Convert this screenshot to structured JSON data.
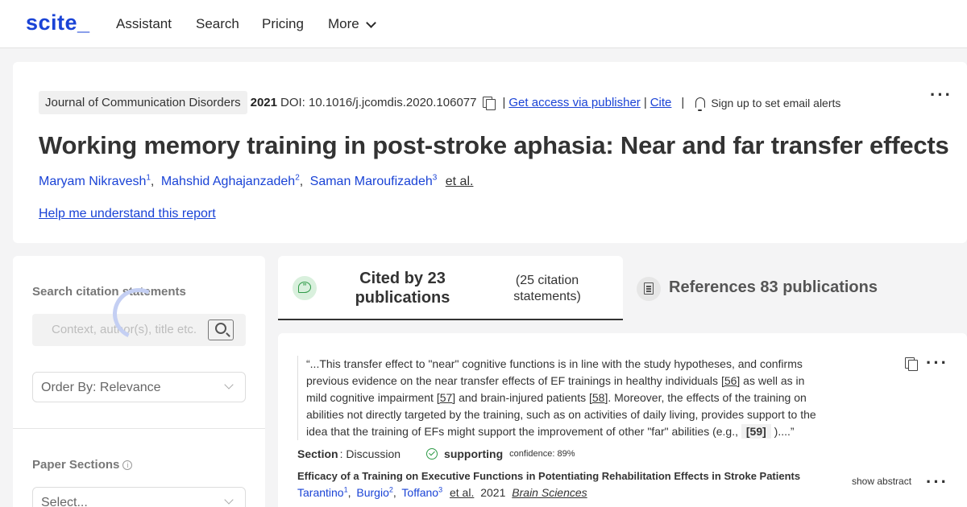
{
  "nav": {
    "logo": "scite_",
    "items": [
      "Assistant",
      "Search",
      "Pricing",
      "More"
    ]
  },
  "header": {
    "journal": "Journal of Communication Disorders",
    "year": "2021",
    "doi": "DOI: 10.1016/j.jcomdis.2020.106077",
    "get_access": "Get access via publisher",
    "cite": "Cite",
    "alerts": "Sign up to set email alerts",
    "title": "Working memory training in post-stroke aphasia: Near and far transfer effects",
    "authors": [
      {
        "name": "Maryam Nikravesh",
        "sup": "1"
      },
      {
        "name": "Mahshid Aghajanzadeh",
        "sup": "2"
      },
      {
        "name": "Saman Maroufizadeh",
        "sup": "3"
      }
    ],
    "etal": "et al.",
    "help_link": "Help me understand this report"
  },
  "sidebar": {
    "search_label": "Search citation statements",
    "search_placeholder": "Context, author(s), title etc.",
    "order_by": "Order By: Relevance",
    "paper_sections_label": "Paper Sections",
    "select_placeholder": "Select..."
  },
  "tabs": {
    "cited_main": "Cited by 23 publications",
    "cited_sub": "(25 citation statements)",
    "references": "References 83 publications"
  },
  "citation": {
    "quote_parts": [
      "“...This transfer effect to \"near\" cognitive functions is in line with the study hypotheses, and confirms previous evidence on the near transfer effects of EF trainings in healthy individuals ",
      "[56]",
      " as well as in mild cognitive impairment ",
      "[57]",
      " and brain-injured patients ",
      "[58]",
      ". Moreover, the effects of the training on abilities not directly targeted by the training, such as on activities of daily living, provides support to the idea that the training of EFs might support the improvement of other \"far\" abilities (e.g., ",
      "[59]",
      " )....”"
    ],
    "section_label": "Section",
    "section_value": ": Discussion",
    "support_label": "supporting",
    "confidence": "confidence: 89%",
    "paper_title": "Efficacy of a Training on Executive Functions in Potentiating Rehabilitation Effects in Stroke Patients",
    "paper_authors": [
      {
        "name": "Tarantino",
        "sup": "1"
      },
      {
        "name": "Burgio",
        "sup": "2"
      },
      {
        "name": "Toffano",
        "sup": "3"
      }
    ],
    "paper_etal": "et al.",
    "paper_year": "2021",
    "paper_journal": "Brain Sciences",
    "show_abstract": "show abstract"
  },
  "colors": {
    "brand": "#1a43d6",
    "supporting": "#2e9a47",
    "background": "#f4f4f5"
  }
}
